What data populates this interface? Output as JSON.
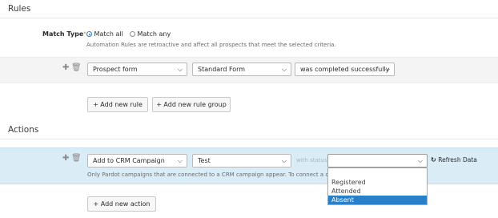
{
  "rules": {
    "title": "Rules",
    "match_type": {
      "label": "Match Type",
      "required_mark": "*",
      "options": [
        "Match all",
        "Match any"
      ],
      "selected": "Match all",
      "hint": "Automation Rules are retroactive and affect all prospects that meet the selected criteria."
    },
    "rule_row": {
      "field": "Prospect form",
      "form": "Standard Form",
      "condition": "was completed successfully"
    },
    "add_rule_label": "+ Add new rule",
    "add_rule_group_label": "+ Add new rule group"
  },
  "actions": {
    "title": "Actions",
    "action_row": {
      "action": "Add to CRM Campaign",
      "campaign": "Test",
      "with_status_label": "with status",
      "status_value": "",
      "refresh_label": "Refresh Data",
      "note": "Only Pardot campaigns that are connected to a CRM campaign appear. To connect a ca"
    },
    "status_options": [
      "",
      "Registered",
      "Attended",
      "Absent"
    ],
    "highlighted_option": "Absent",
    "add_action_label": "+ Add new action"
  },
  "colors": {
    "accent": "#2a7fc9",
    "rule_row_bg": "#f4f4f4",
    "action_row_bg": "#daedf7",
    "required": "#e08a00"
  },
  "icons": {
    "add": "plus-icon",
    "delete": "trash-icon",
    "refresh": "refresh-icon",
    "dropdown": "chevron-down-icon"
  }
}
